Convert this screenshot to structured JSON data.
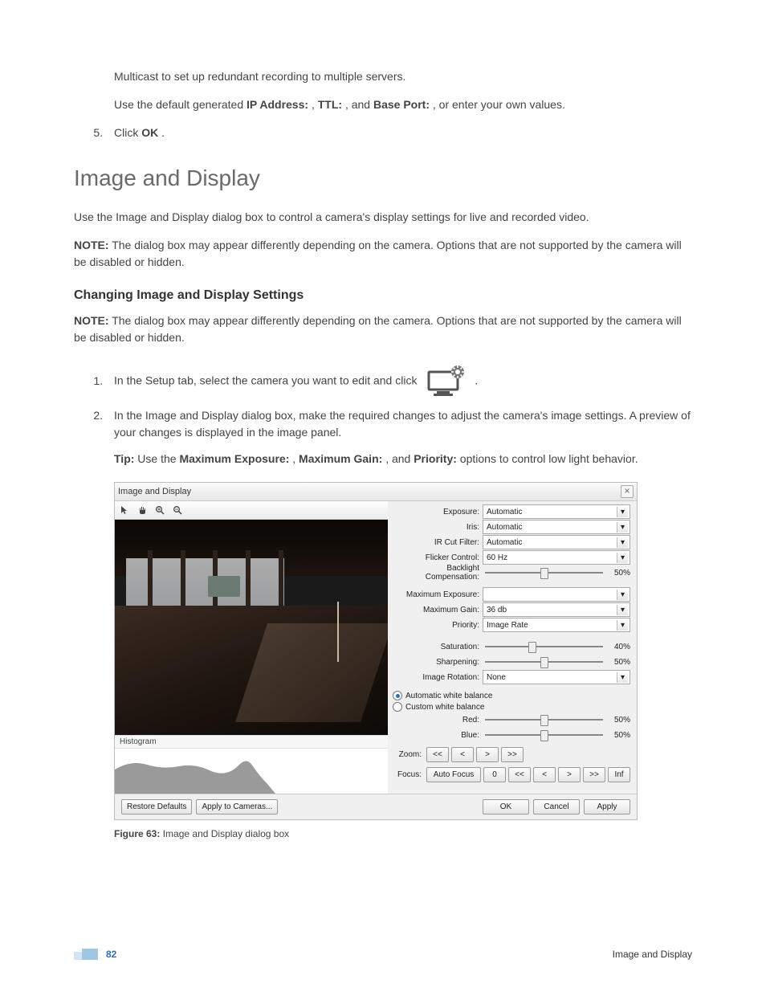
{
  "intro": {
    "para1": "Multicast to set up redundant recording to multiple servers.",
    "para2_a": "Use the default generated ",
    "para2_b_ip": "IP Address:",
    "para2_c": ", ",
    "para2_d_ttl": "TTL:",
    "para2_e": ", and ",
    "para2_f_bp": "Base Port:",
    "para2_g": ", or enter your own values.",
    "step5_a": "Click ",
    "step5_b_ok": "OK",
    "step5_c": "."
  },
  "section": {
    "title": "Image and Display",
    "intro": "Use the Image and Display dialog box to control a camera's display settings for live and recorded video.",
    "note_label": "NOTE:",
    "note_text": " The dialog box may appear differently depending on the camera. Options that are not supported by the camera will be disabled or hidden.",
    "subhead": "Changing Image and Display Settings",
    "steps": {
      "s1_a": "In the Setup tab, select the camera you want to edit and click ",
      "s1_b": " .",
      "s2": "In the Image and Display dialog box, make the required changes to adjust the camera's image settings. A preview of your changes is displayed in the image panel.",
      "tip_label": "Tip:",
      "tip_a": " Use the ",
      "tip_me": "Maximum Exposure:",
      "tip_b": ", ",
      "tip_mg": "Maximum Gain:",
      "tip_c": ", and ",
      "tip_pr": "Priority:",
      "tip_d": " options to control low light behavior."
    }
  },
  "dialog": {
    "title": "Image and Display",
    "histogram_label": "Histogram",
    "labels": {
      "exposure": "Exposure:",
      "iris": "Iris:",
      "ir": "IR Cut Filter:",
      "flicker": "Flicker Control:",
      "backlight": "Backlight Compensation:",
      "maxexp": "Maximum Exposure:",
      "maxgain": "Maximum Gain:",
      "priority": "Priority:",
      "saturation": "Saturation:",
      "sharpening": "Sharpening:",
      "rotation": "Image Rotation:",
      "awb": "Automatic white balance",
      "cwb": "Custom white balance",
      "red": "Red:",
      "blue": "Blue:",
      "zoom": "Zoom:",
      "focus": "Focus:"
    },
    "values": {
      "exposure": "Automatic",
      "iris": "Automatic",
      "ir": "Automatic",
      "flicker": "60 Hz",
      "backlight": "50%",
      "maxexp": "",
      "maxgain": "36 db",
      "priority": "Image Rate",
      "saturation": "40%",
      "sharpening": "50%",
      "rotation": "None",
      "red": "50%",
      "blue": "50%"
    },
    "sliders": {
      "backlight": 50,
      "saturation": 40,
      "sharpening": 50,
      "red": 50,
      "blue": 50
    },
    "zoom_buttons": [
      "<<",
      "<",
      ">",
      ">>"
    ],
    "focus_buttons": {
      "auto": "Auto Focus",
      "zero": "0",
      "bkfast": "<<",
      "bk": "<",
      "fw": ">",
      "fwfast": ">>",
      "inf": "Inf"
    },
    "footer": {
      "restore": "Restore Defaults",
      "apply_cam": "Apply to Cameras...",
      "ok": "OK",
      "cancel": "Cancel",
      "apply": "Apply"
    }
  },
  "caption": {
    "label": "Figure 63:",
    "text": " Image and Display dialog box"
  },
  "footer": {
    "page": "82",
    "title": "Image and Display"
  }
}
